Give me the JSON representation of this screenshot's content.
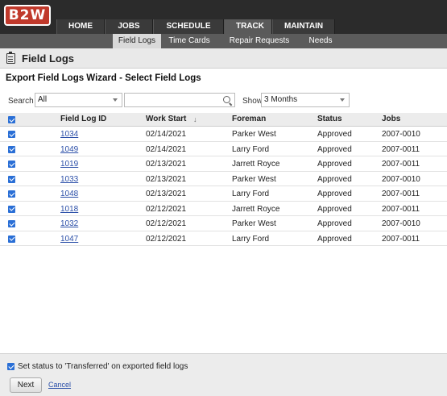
{
  "app": {
    "logo_text": "B2W"
  },
  "nav": [
    {
      "label": "HOME"
    },
    {
      "label": "JOBS"
    },
    {
      "label": "SCHEDULE"
    },
    {
      "label": "TRACK",
      "active": true
    },
    {
      "label": "MAINTAIN"
    }
  ],
  "subnav": [
    {
      "label": "Field Logs",
      "active": true
    },
    {
      "label": "Time Cards"
    },
    {
      "label": "Repair Requests"
    },
    {
      "label": "Needs"
    }
  ],
  "page": {
    "title": "Field Logs",
    "wizard_title": "Export Field Logs Wizard - Select Field Logs"
  },
  "filters": {
    "search_label": "Search",
    "search_scope": "All",
    "search_value": "",
    "show_label": "Show",
    "show_value": "3 Months"
  },
  "table": {
    "columns": [
      "Field Log ID",
      "Work Start",
      "Foreman",
      "Status",
      "Jobs"
    ],
    "sort_indicator": "↓",
    "rows": [
      {
        "id": "1034",
        "work_start": "02/14/2021",
        "foreman": "Parker West",
        "status": "Approved",
        "jobs": "2007-0010",
        "checked": true
      },
      {
        "id": "1049",
        "work_start": "02/14/2021",
        "foreman": "Larry Ford",
        "status": "Approved",
        "jobs": "2007-0011",
        "checked": true
      },
      {
        "id": "1019",
        "work_start": "02/13/2021",
        "foreman": "Jarrett Royce",
        "status": "Approved",
        "jobs": "2007-0011",
        "checked": true
      },
      {
        "id": "1033",
        "work_start": "02/13/2021",
        "foreman": "Parker West",
        "status": "Approved",
        "jobs": "2007-0010",
        "checked": true
      },
      {
        "id": "1048",
        "work_start": "02/13/2021",
        "foreman": "Larry Ford",
        "status": "Approved",
        "jobs": "2007-0011",
        "checked": true
      },
      {
        "id": "1018",
        "work_start": "02/12/2021",
        "foreman": "Jarrett Royce",
        "status": "Approved",
        "jobs": "2007-0011",
        "checked": true
      },
      {
        "id": "1032",
        "work_start": "02/12/2021",
        "foreman": "Parker West",
        "status": "Approved",
        "jobs": "2007-0010",
        "checked": true
      },
      {
        "id": "1047",
        "work_start": "02/12/2021",
        "foreman": "Larry Ford",
        "status": "Approved",
        "jobs": "2007-0011",
        "checked": true
      }
    ]
  },
  "footer": {
    "transfer_checked": true,
    "transfer_label": "Set status to 'Transferred' on exported field logs",
    "next_label": "Next",
    "cancel_label": "Cancel"
  },
  "colors": {
    "accent": "#c0392b",
    "link": "#2b4fa8",
    "checkbox": "#2a6fd6"
  }
}
